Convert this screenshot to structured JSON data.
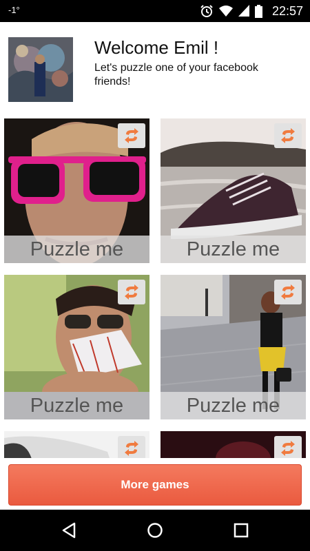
{
  "status_bar": {
    "left_indicator": "-1°",
    "time": "22:57",
    "icons": [
      "alarm-icon",
      "wifi-icon",
      "signal-icon",
      "battery-icon"
    ]
  },
  "header": {
    "avatar_icon": "profile-photo",
    "title": "Welcome Emil !",
    "subtitle": "Let's puzzle one of your facebook friends!"
  },
  "tiles": [
    {
      "label": "Puzzle me",
      "icon": "swap-icon"
    },
    {
      "label": "Puzzle me",
      "icon": "swap-icon"
    },
    {
      "label": "Puzzle me",
      "icon": "swap-icon"
    },
    {
      "label": "Puzzle me",
      "icon": "swap-icon"
    },
    {
      "label": "",
      "icon": "swap-icon"
    },
    {
      "label": "",
      "icon": "swap-icon"
    }
  ],
  "more_games_label": "More games",
  "nav": [
    "back-icon",
    "home-icon",
    "recent-apps-icon"
  ],
  "colors": {
    "accent": "#ee6a4d",
    "swap_icon": "#f07b3f",
    "tile_label_bg": "#e1e1e1"
  }
}
